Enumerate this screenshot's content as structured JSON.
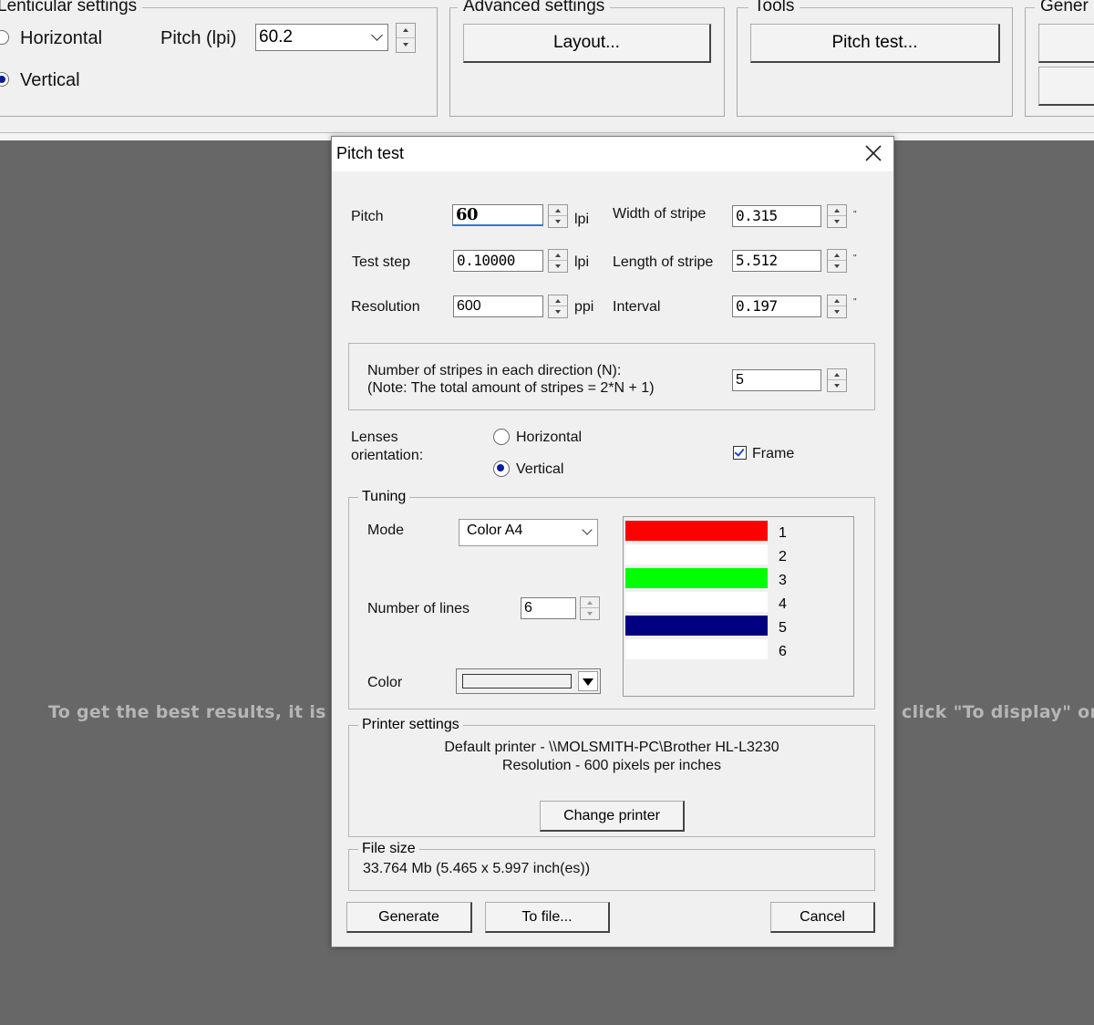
{
  "toolbar": {
    "lenticular_title": "Lenticular settings",
    "horizontal_label": "Horizontal",
    "vertical_label": "Vertical",
    "pitch_label": "Pitch (lpi)",
    "pitch_value": "60.2",
    "advanced_title": "Advanced settings",
    "layout_button": "Layout...",
    "tools_title": "Tools",
    "pitch_test_button": "Pitch test...",
    "general_title": "Gener"
  },
  "background": {
    "message_left": "To get the best results, it is rec",
    "message_right": "click \"To display\" or \""
  },
  "dialog": {
    "title": "Pitch test",
    "pitch_label": "Pitch",
    "pitch_value": "60",
    "pitch_unit": "lpi",
    "test_step_label": "Test step",
    "test_step_value": "0.10000",
    "test_step_unit": "lpi",
    "resolution_label": "Resolution",
    "resolution_value": "600",
    "resolution_unit": "ppi",
    "width_label": "Width of stripe",
    "width_value": "0.315",
    "length_label": "Length of stripe",
    "length_value": "5.512",
    "interval_label": "Interval",
    "interval_value": "0.197",
    "inch_mark": "\"",
    "stripes_line1": "Number of stripes in each direction (N):",
    "stripes_line2": "(Note: The total amount of stripes = 2*N + 1)",
    "stripes_value": "5",
    "orientation_label_1": "Lenses",
    "orientation_label_2": "orientation:",
    "orientation_horizontal": "Horizontal",
    "orientation_vertical": "Vertical",
    "frame_label": "Frame",
    "tuning_title": "Tuning",
    "mode_label": "Mode",
    "mode_value": "Color A4",
    "lines_label": "Number of lines",
    "lines_value": "6",
    "color_label": "Color",
    "preview_numbers": [
      "1",
      "2",
      "3",
      "4",
      "5",
      "6"
    ],
    "preview_colors": [
      "#ff0000",
      "#ffffff",
      "#00ff00",
      "#ffffff",
      "#000080",
      "#ffffff"
    ],
    "printer_title": "Printer settings",
    "printer_line1": "Default printer - \\\\MOLSMITH-PC\\Brother HL-L3230",
    "printer_line2": "Resolution - 600 pixels per inches",
    "change_printer": "Change printer",
    "file_size_title": "File size",
    "file_size_value": "33.764 Mb (5.465 x 5.997 inch(es))",
    "generate_button": "Generate",
    "to_file_button": "To file...",
    "cancel_button": "Cancel"
  }
}
